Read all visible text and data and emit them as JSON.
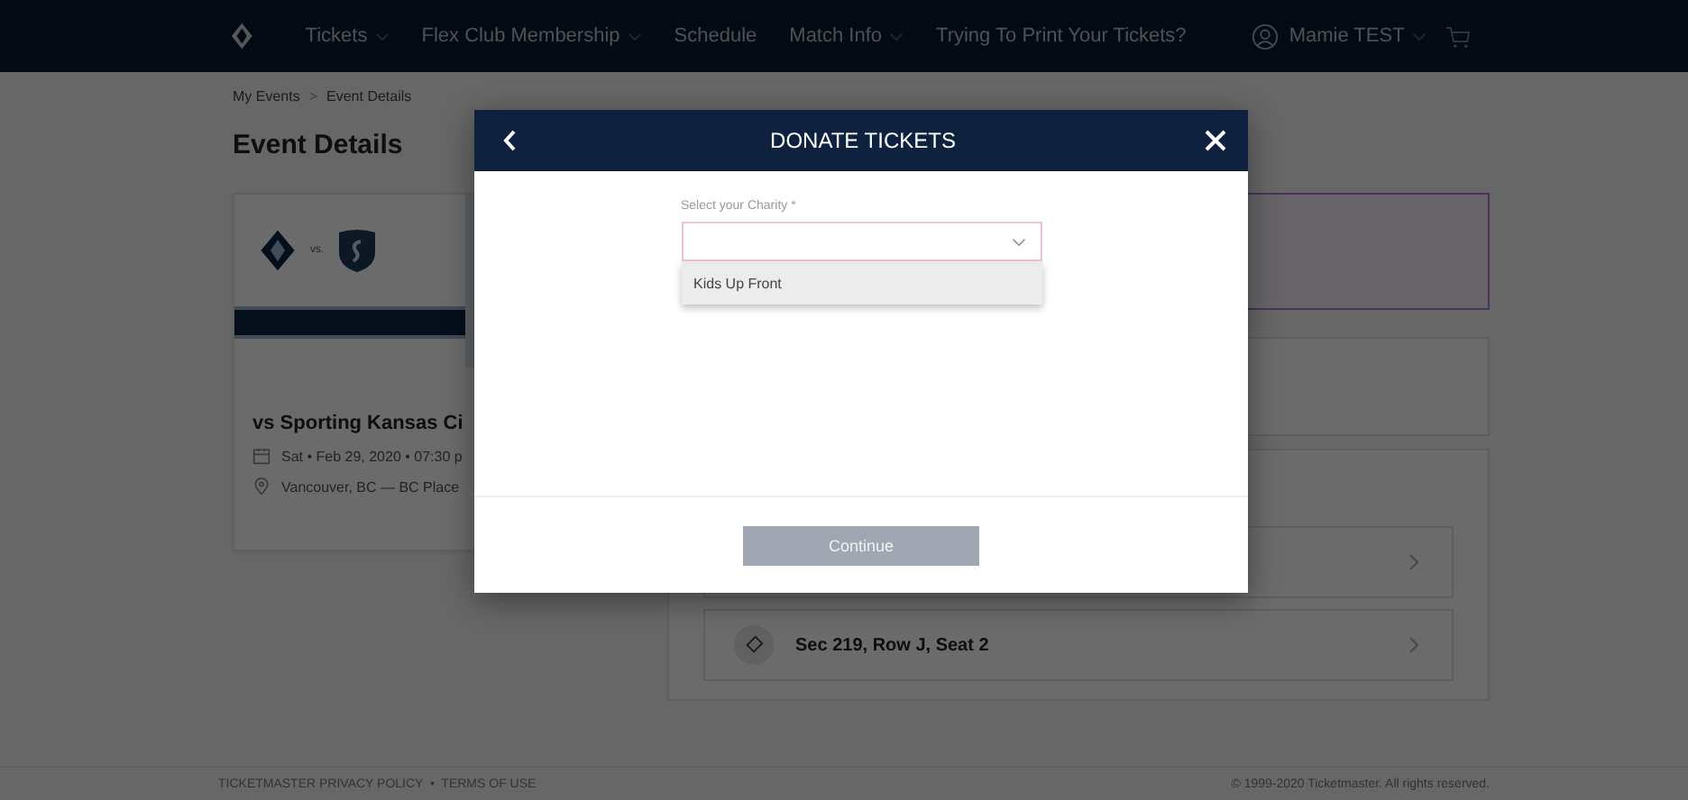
{
  "nav": {
    "items": [
      {
        "label": "Tickets",
        "dropdown": true
      },
      {
        "label": "Flex Club Membership",
        "dropdown": true
      },
      {
        "label": "Schedule",
        "dropdown": false
      },
      {
        "label": "Match Info",
        "dropdown": true
      },
      {
        "label": "Trying To Print Your Tickets?",
        "dropdown": false
      }
    ],
    "user": {
      "name": "Mamie TEST",
      "dropdown": true
    }
  },
  "breadcrumb": [
    "My Events",
    "Event Details"
  ],
  "breadcrumb_separator": ">",
  "page_title": "Event Details",
  "event": {
    "versus": "vs.",
    "title": "vs Sporting Kansas Ci",
    "date": "Sat • Feb 29, 2020 • 07:30 p",
    "venue": "Vancouver, BC — BC Place"
  },
  "tickets": [
    {
      "label": "Sec 219, Row J, Seat 2"
    }
  ],
  "footer": {
    "links": "TICKETMASTER PRIVACY POLICY  •  TERMS OF USE",
    "copyright": "© 1999-2020 Ticketmaster. All rights reserved."
  },
  "modal": {
    "title": "DONATE TICKETS",
    "field_label": "Select your Charity *",
    "options": [
      {
        "label": "Kids Up Front",
        "highlighted": true
      }
    ],
    "button": {
      "label": "Continue",
      "disabled": true
    }
  }
}
